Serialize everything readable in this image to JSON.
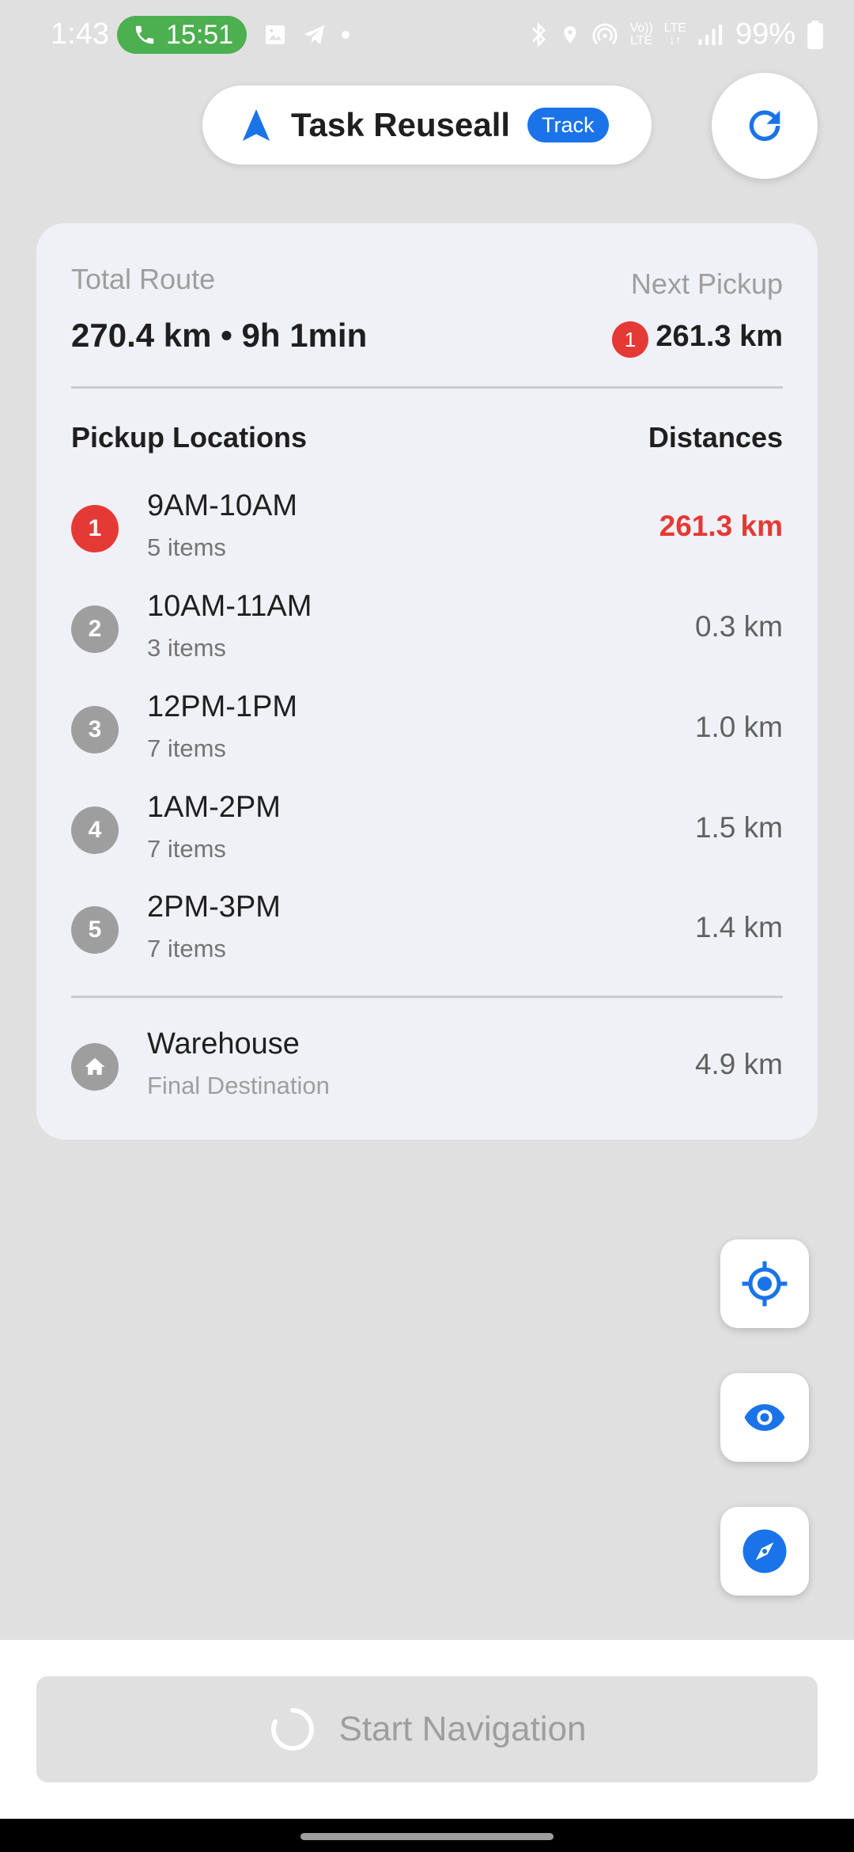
{
  "status_bar": {
    "time": "1:43",
    "call_duration": "15:51",
    "network_top": "Vo))",
    "network_bottom": "LTE",
    "lte_top": "LTE",
    "lte_arrows": "↓↑",
    "battery": "99%"
  },
  "header": {
    "title": "Task Reuseall",
    "badge": "Track"
  },
  "summary": {
    "total_route_label": "Total Route",
    "total_route_value": "270.4 km • 9h 1min",
    "next_pickup_label": "Next Pickup",
    "next_pickup_number": "1",
    "next_pickup_distance": "261.3 km"
  },
  "locations": {
    "heading": "Pickup Locations",
    "distances_heading": "Distances",
    "items": [
      {
        "number": "1",
        "time": "9AM-10AM",
        "items": "5 items",
        "distance": "261.3 km",
        "active": true
      },
      {
        "number": "2",
        "time": "10AM-11AM",
        "items": "3 items",
        "distance": "0.3 km",
        "active": false
      },
      {
        "number": "3",
        "time": "12PM-1PM",
        "items": "7 items",
        "distance": "1.0 km",
        "active": false
      },
      {
        "number": "4",
        "time": "1AM-2PM",
        "items": "7 items",
        "distance": "1.5 km",
        "active": false
      },
      {
        "number": "5",
        "time": "2PM-3PM",
        "items": "7 items",
        "distance": "1.4 km",
        "active": false
      }
    ]
  },
  "destination": {
    "name": "Warehouse",
    "subtitle": "Final Destination",
    "distance": "4.9 km"
  },
  "actions": {
    "start_navigation": "Start Navigation"
  },
  "colors": {
    "accent": "#1a73e8",
    "active": "#e53935",
    "inactive": "#9e9e9e"
  }
}
